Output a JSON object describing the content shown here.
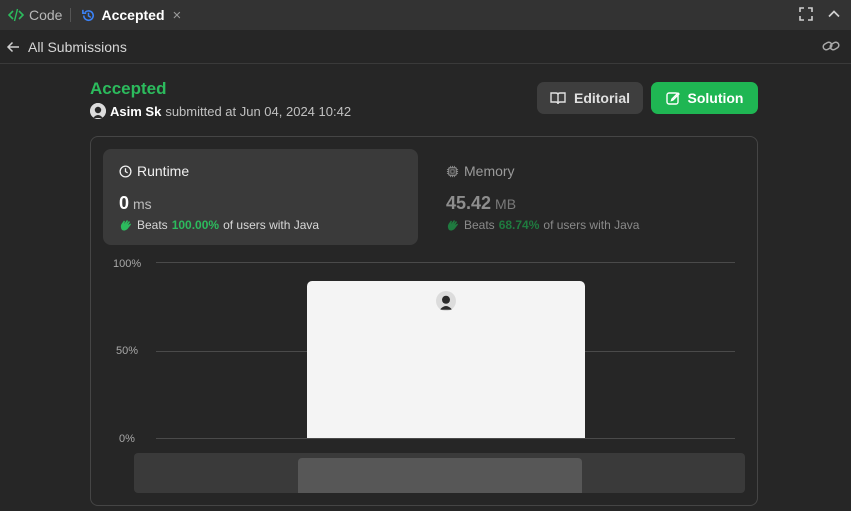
{
  "tabs": {
    "code_label": "Code",
    "accepted_label": "Accepted",
    "close_glyph": "×"
  },
  "header": {
    "back_label": "All Submissions"
  },
  "submission": {
    "status": "Accepted",
    "username": "Asim Sk",
    "submitted_text": "submitted at Jun 04, 2024 10:42"
  },
  "buttons": {
    "editorial": "Editorial",
    "solution": "Solution"
  },
  "runtime": {
    "label": "Runtime",
    "value": "0",
    "unit": "ms",
    "beats_prefix": "Beats",
    "beats_pct": "100.00%",
    "beats_suffix": "of users with Java"
  },
  "memory": {
    "label": "Memory",
    "value": "45.42",
    "unit": "MB",
    "beats_prefix": "Beats",
    "beats_pct": "68.74%",
    "beats_suffix": "of users with Java"
  },
  "chart_data": {
    "type": "bar",
    "yticks": [
      "100%",
      "50%",
      "0%"
    ],
    "ylim": [
      0,
      100
    ],
    "bars": [
      {
        "value": 89,
        "highlighted": true
      }
    ]
  },
  "colors": {
    "accent_green": "#2cbb5d",
    "solution_button": "#1fb653",
    "background": "#262626"
  },
  "icons": {
    "code": "code-brackets-icon",
    "history": "history-icon",
    "fullscreen": "fullscreen-icon",
    "collapse": "chevron-up-icon",
    "back": "arrow-left-icon",
    "share": "link-icon",
    "editorial": "book-icon",
    "solution": "edit-icon",
    "runtime": "clock-icon",
    "memory": "chip-icon",
    "beats": "clap-hands-icon"
  }
}
